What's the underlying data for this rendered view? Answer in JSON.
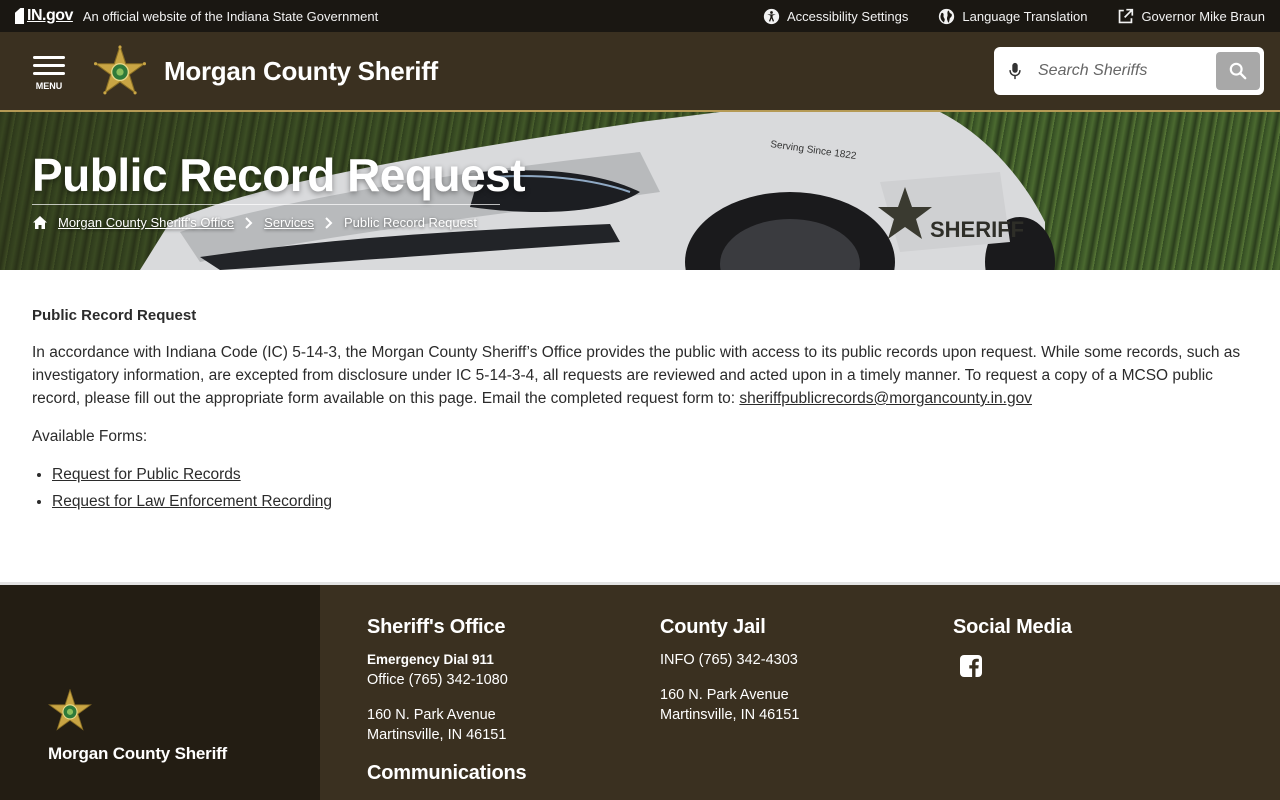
{
  "state_bar": {
    "logo_text": "IN.gov",
    "official_text": "An official website of the Indiana State Government",
    "links": [
      {
        "label": "Accessibility Settings",
        "icon": "accessibility-icon"
      },
      {
        "label": "Language Translation",
        "icon": "globe-icon"
      },
      {
        "label": "Governor Mike Braun",
        "icon": "external-link-icon"
      }
    ]
  },
  "header": {
    "menu_label": "MENU",
    "site_title": "Morgan County Sheriff",
    "search_placeholder": "Search Sheriffs"
  },
  "hero": {
    "title": "Public Record Request",
    "breadcrumb": [
      "Morgan County Sheriff's Office",
      "Services",
      "Public Record Request"
    ]
  },
  "main": {
    "heading": "Public Record Request",
    "paragraph": "In accordance with Indiana Code (IC) 5-14-3, the Morgan County Sheriff’s Office provides the public with access to its public records upon request. While some records, such as investigatory information, are excepted from disclosure under IC 5-14-3-4, all requests are reviewed and acted upon in a timely manner. To request a copy of a MCSO public record, please fill out the appropriate form available on this page. Email the completed request form to:",
    "email": "sheriffpublicrecords@morgancounty.in.gov",
    "forms_label": "Available Forms:",
    "forms": [
      "Request for Public Records",
      "Request for Law Enforcement Recording"
    ]
  },
  "footer": {
    "brand": "Morgan County Sheriff",
    "sheriffs_office": {
      "heading": "Sheriff's Office",
      "emergency": "Emergency Dial 911",
      "office_phone": "Office (765) 342-1080",
      "address_line1": "160 N. Park Avenue",
      "address_line2": "Martinsville, IN 46151"
    },
    "communications_heading": "Communications",
    "county_jail": {
      "heading": "County Jail",
      "info_phone": "INFO (765) 342-4303",
      "address_line1": "160 N. Park Avenue",
      "address_line2": "Martinsville, IN 46151"
    },
    "social": {
      "heading": "Social Media",
      "icon": "facebook-icon"
    }
  },
  "colors": {
    "header_bg": "#3a3020",
    "state_bar_bg": "#1a1712",
    "accent_gold": "#b59a55",
    "footer_left_bg": "#231d13"
  }
}
